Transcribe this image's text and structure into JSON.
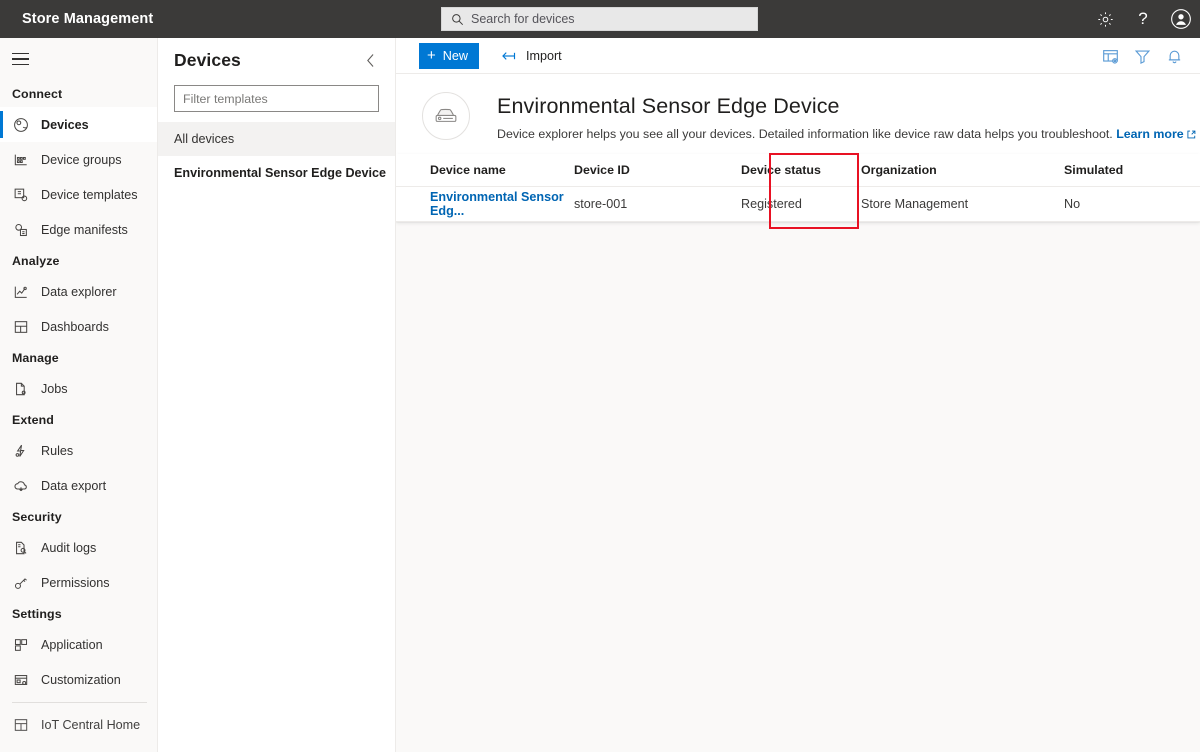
{
  "topbar": {
    "title": "Store Management",
    "search_placeholder": "Search for devices",
    "search_value": "",
    "search_icon": "search-icon",
    "settings_icon": "gear-icon",
    "help_icon": "help-question-icon",
    "account_icon": "account-avatar-icon"
  },
  "leftnav": {
    "menu_icon": "hamburger-menu-icon",
    "sections": [
      {
        "label": "Connect",
        "items": [
          {
            "label": "Devices",
            "icon": "devices-icon",
            "selected": true
          },
          {
            "label": "Device groups",
            "icon": "device-groups-icon",
            "selected": false
          },
          {
            "label": "Device templates",
            "icon": "device-templates-icon",
            "selected": false
          },
          {
            "label": "Edge manifests",
            "icon": "edge-manifests-icon",
            "selected": false
          }
        ]
      },
      {
        "label": "Analyze",
        "items": [
          {
            "label": "Data explorer",
            "icon": "data-explorer-icon",
            "selected": false
          },
          {
            "label": "Dashboards",
            "icon": "dashboards-icon",
            "selected": false
          }
        ]
      },
      {
        "label": "Manage",
        "items": [
          {
            "label": "Jobs",
            "icon": "jobs-icon",
            "selected": false
          }
        ]
      },
      {
        "label": "Extend",
        "items": [
          {
            "label": "Rules",
            "icon": "rules-icon",
            "selected": false
          },
          {
            "label": "Data export",
            "icon": "data-export-icon",
            "selected": false
          }
        ]
      },
      {
        "label": "Security",
        "items": [
          {
            "label": "Audit logs",
            "icon": "audit-logs-icon",
            "selected": false
          },
          {
            "label": "Permissions",
            "icon": "permissions-key-icon",
            "selected": false
          }
        ]
      },
      {
        "label": "Settings",
        "items": [
          {
            "label": "Application",
            "icon": "application-icon",
            "selected": false
          },
          {
            "label": "Customization",
            "icon": "customization-icon",
            "selected": false
          }
        ]
      }
    ],
    "footer_item": {
      "label": "IoT Central Home",
      "icon": "iot-central-home-icon"
    }
  },
  "templates_panel": {
    "title": "Devices",
    "collapse_icon": "chevron-left-icon",
    "filter_placeholder": "Filter templates",
    "filter_value": "",
    "group_label": "All devices",
    "items": [
      {
        "label": "Environmental Sensor Edge Device",
        "active": true
      }
    ]
  },
  "commandbar": {
    "new_label": "New",
    "new_icon": "plus-icon",
    "import_label": "Import",
    "import_icon": "import-arrow-icon",
    "right_icons": [
      {
        "name": "column-options-icon"
      },
      {
        "name": "filter-funnel-icon"
      },
      {
        "name": "notification-bell-icon"
      }
    ]
  },
  "page_header": {
    "avatar_icon": "edge-device-icon",
    "title": "Environmental Sensor Edge Device",
    "subtitle": "Device explorer helps you see all your devices. Detailed information like device raw data helps you troubleshoot.",
    "link_label": "Learn more",
    "link_icon": "external-link-icon"
  },
  "devices_table": {
    "columns": [
      "Device name",
      "Device ID",
      "Device status",
      "Organization",
      "Simulated"
    ],
    "rows": [
      {
        "device_name": "Environmental Sensor Edg...",
        "device_id": "store-001",
        "device_status": "Registered",
        "organization": "Store Management",
        "simulated": "No"
      }
    ]
  },
  "annotation": {
    "highlight_target": "device-status-column",
    "color": "#e81123"
  }
}
